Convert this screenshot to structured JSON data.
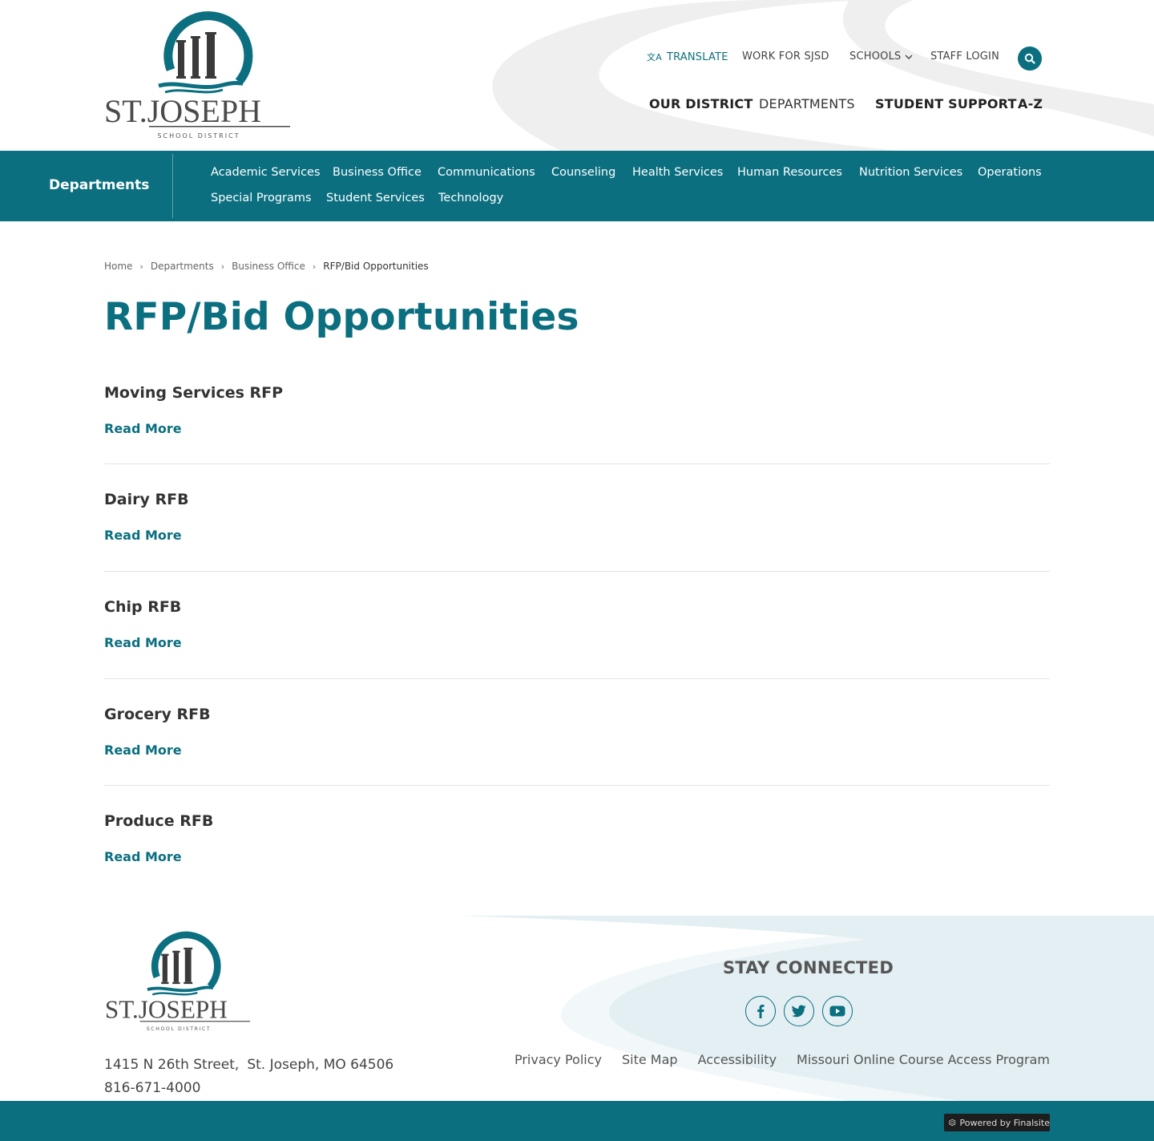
{
  "header": {
    "logo_name": "ST.JOSEPH",
    "logo_subtitle": "SCHOOL DISTRICT",
    "utility": {
      "translate": "TRANSLATE",
      "translate_icon": "translate-icon",
      "work": "WORK FOR SJSD",
      "schools": "SCHOOLS",
      "staff_login": "STAFF LOGIN"
    },
    "main_nav": {
      "our_district": "OUR DISTRICT",
      "departments": "DEPARTMENTS",
      "student_support": "STUDENT SUPPORT",
      "az": "A-Z"
    }
  },
  "dept_bar": {
    "title": "Departments",
    "links": [
      {
        "label": "Academic Services"
      },
      {
        "label": "Business Office"
      },
      {
        "label": "Communications"
      },
      {
        "label": "Counseling"
      },
      {
        "label": "Health Services"
      },
      {
        "label": "Human Resources"
      },
      {
        "label": "Nutrition Services"
      },
      {
        "label": "Operations"
      },
      {
        "label": "Special Programs"
      },
      {
        "label": "Student Services"
      },
      {
        "label": "Technology"
      }
    ]
  },
  "breadcrumb": {
    "home": "Home",
    "departments": "Departments",
    "business_office": "Business Office",
    "current": "RFP/Bid Opportunities"
  },
  "page": {
    "title": "RFP/Bid Opportunities",
    "read_more_label": "Read More",
    "items": [
      {
        "title": "Moving Services RFP"
      },
      {
        "title": "Dairy RFB"
      },
      {
        "title": "Chip RFB"
      },
      {
        "title": "Grocery RFB"
      },
      {
        "title": "Produce RFB"
      }
    ]
  },
  "footer": {
    "logo_name": "ST.JOSEPH",
    "logo_subtitle": "SCHOOL DISTRICT",
    "address_street": "1415 N 26th Street,",
    "address_city": "St. Joseph, MO  64506",
    "phone": "816-671-4000",
    "stay_connected": "STAY CONNECTED",
    "social": [
      "facebook-icon",
      "twitter-icon",
      "youtube-icon"
    ],
    "links": {
      "privacy": "Privacy Policy",
      "sitemap": "Site Map",
      "accessibility": "Accessibility",
      "missouri": "Missouri Online Course Access Program"
    },
    "powered_by": "Powered by Finalsite"
  },
  "colors": {
    "brand_teal": "#0b6f80",
    "text_dark": "#333333",
    "swoosh_gray": "#efefef",
    "footer_light": "#e3eff3"
  }
}
